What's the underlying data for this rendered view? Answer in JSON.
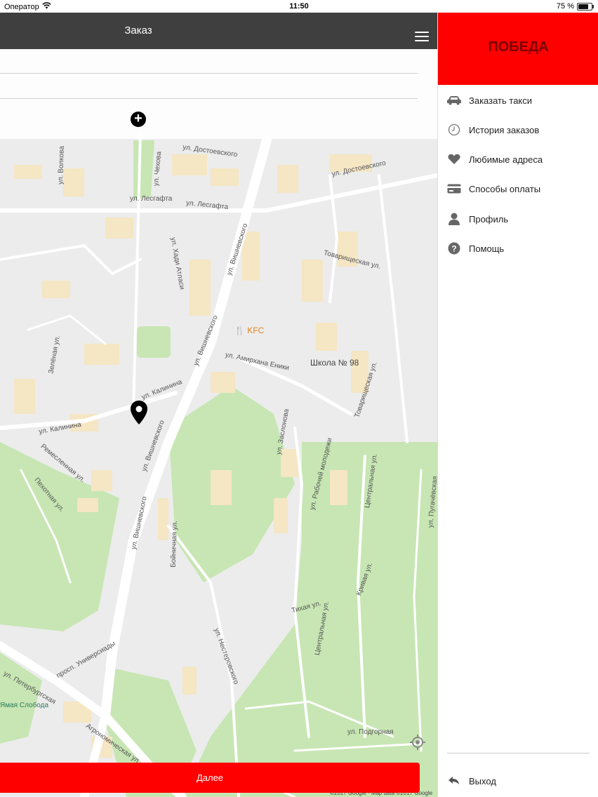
{
  "status_bar": {
    "carrier": "Оператор",
    "time": "11:50",
    "battery": "75 %",
    "battery_level": 0.75
  },
  "navbar": {
    "title": "Заказ"
  },
  "order_form": {
    "add_stop_icon": "plus-circle-icon"
  },
  "map": {
    "street_labels": [
      "ул. Достоевского",
      "ул. Достоевского",
      "ул. Лесгафта",
      "ул. Лесгафта",
      "ул. Вишневского",
      "ул. Вишневского",
      "ул. Вишневского",
      "ул. Вишневского",
      "ул. Амирхана Еники",
      "ул. Калинина",
      "ул. Калинина",
      "Товарищеская ул.",
      "Товарищеская ул.",
      "Центральная ул.",
      "Центральная ул.",
      "ул. Рабочей молодежи",
      "ул. Заслонова",
      "Бойничная ул.",
      "ул. Подгорная",
      "Тихая ул.",
      "Кривая ул.",
      "ул. Пугачёвская",
      "ул. Волкова",
      "ул. Чехова",
      "ул. Хади Атласи",
      "Зелёная ул.",
      "просп. Универсиады",
      "Агрономическая ул.",
      "ул. Петербургская",
      "Ремесленная ул.",
      "Пехотная ул.",
      "ул. Нестеровского"
    ],
    "poi_kfc": "KFC",
    "poi_school": "Школа № 98",
    "metro": "Ямая Слобода",
    "attribution": "©2017 Google · Map data ©2017 Google",
    "locate_icon": "crosshair-icon",
    "pin_icon": "map-pin-icon"
  },
  "next_button": {
    "label": "Далее"
  },
  "sidebar": {
    "logo": "ПОБЕДА",
    "colors": {
      "brand": "#ff0000",
      "logo_text": "#7a0000"
    },
    "menu": [
      {
        "label": "Заказать такси",
        "icon": "car-icon"
      },
      {
        "label": "История заказов",
        "icon": "clock-icon"
      },
      {
        "label": "Любимые адреса",
        "icon": "heart-icon"
      },
      {
        "label": "Способы оплаты",
        "icon": "credit-card-icon"
      },
      {
        "label": "Профиль",
        "icon": "person-icon"
      },
      {
        "label": "Помощь",
        "icon": "help-icon"
      }
    ],
    "logout": {
      "label": "Выход",
      "icon": "back-arrow-icon"
    }
  }
}
